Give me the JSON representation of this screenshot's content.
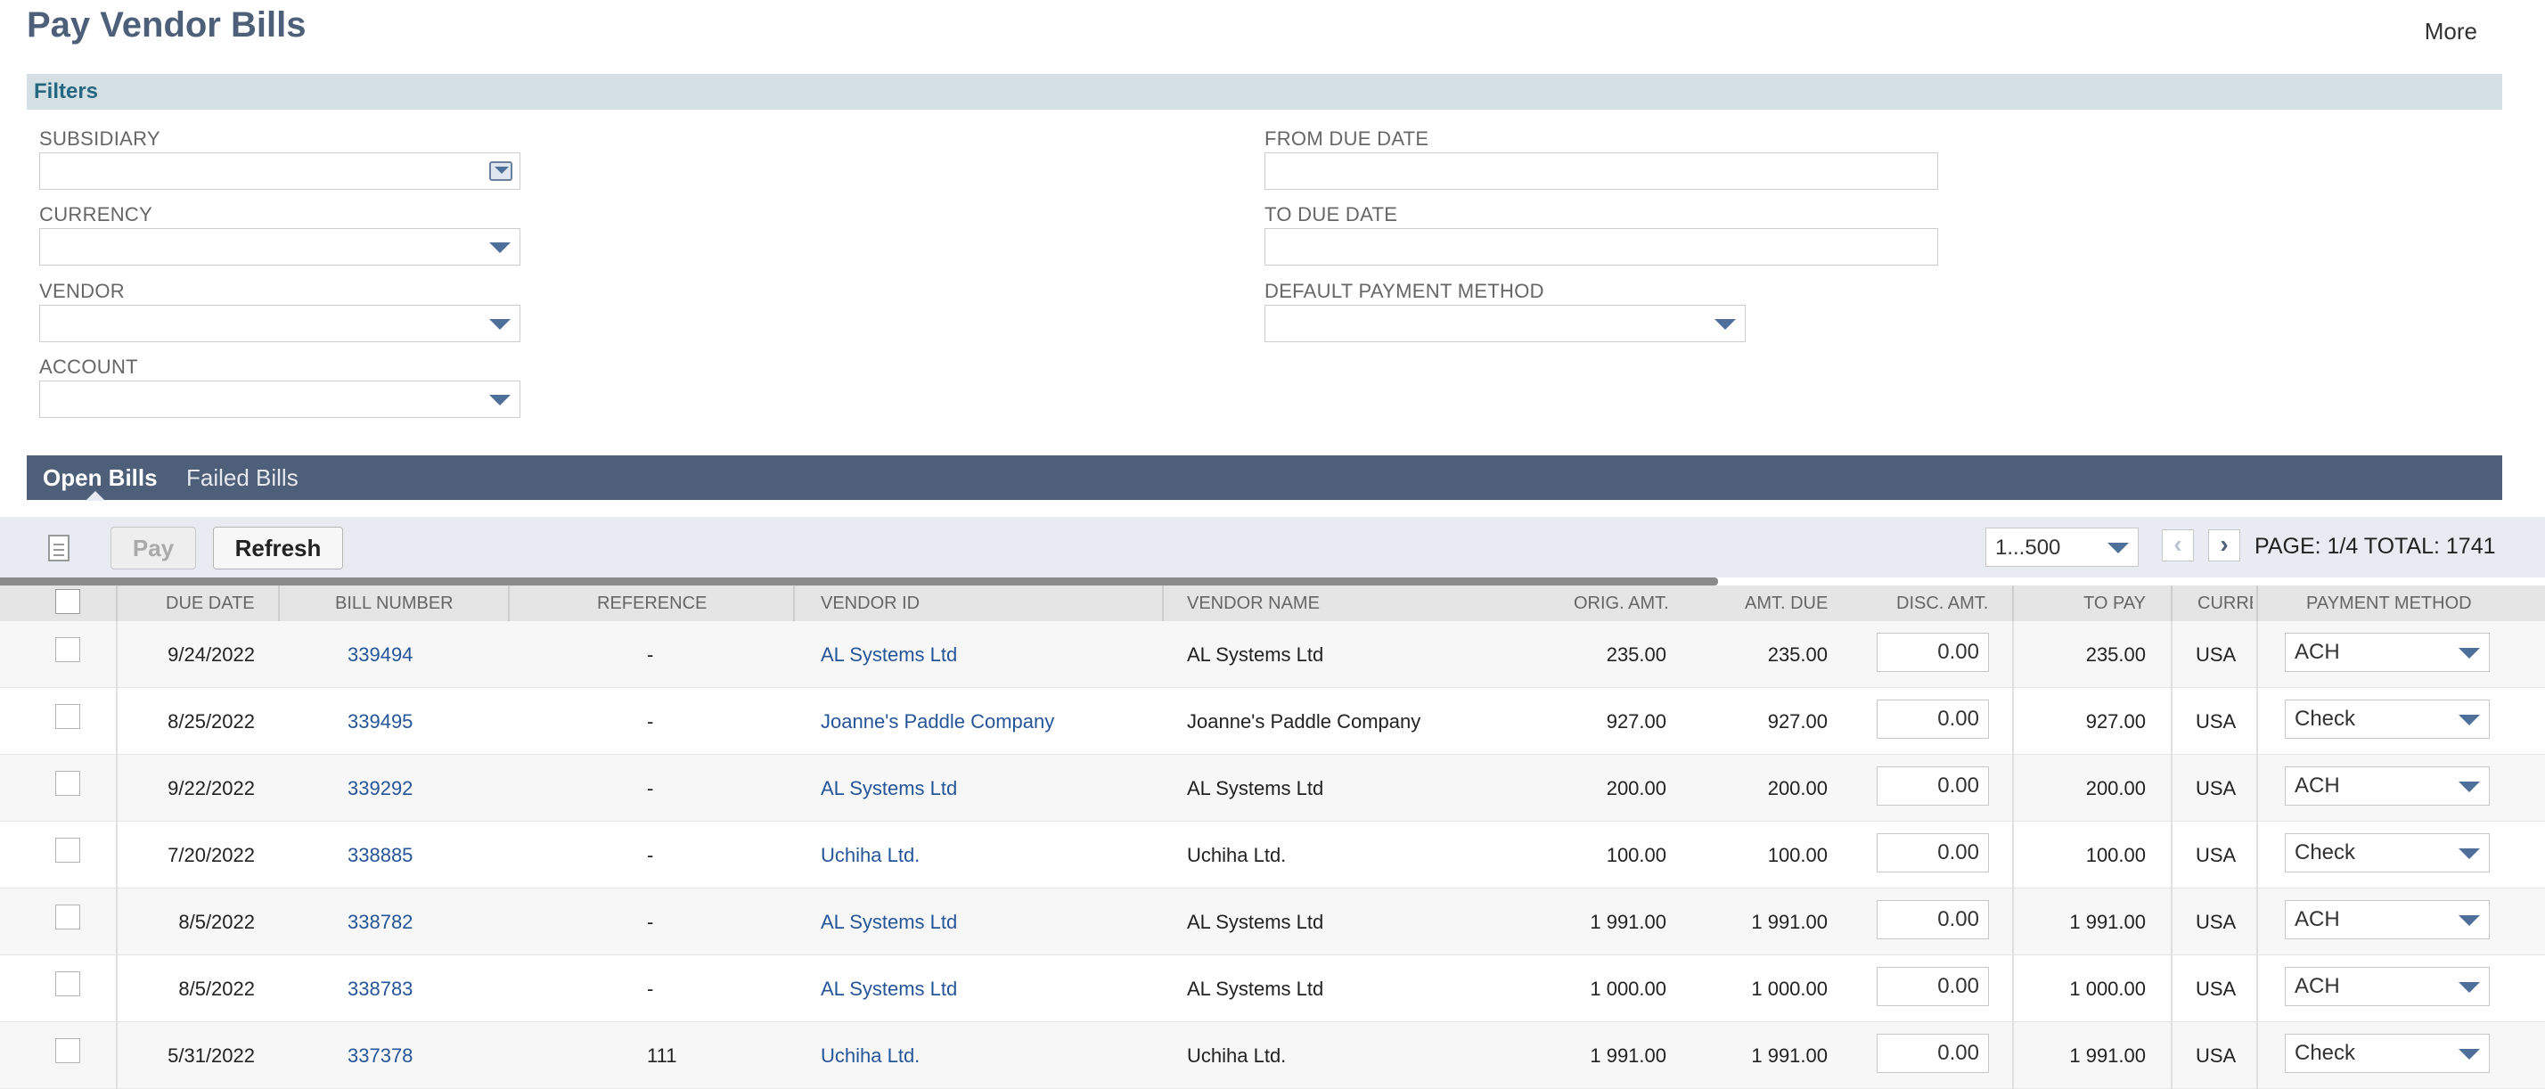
{
  "page": {
    "title": "Pay Vendor Bills",
    "more_label": "More"
  },
  "filters": {
    "section_label": "Filters",
    "subsidiary": {
      "label": "SUBSIDIARY",
      "value": ""
    },
    "currency": {
      "label": "CURRENCY",
      "value": ""
    },
    "vendor": {
      "label": "VENDOR",
      "value": ""
    },
    "account": {
      "label": "ACCOUNT",
      "value": ""
    },
    "from_due_date": {
      "label": "FROM DUE DATE",
      "value": ""
    },
    "to_due_date": {
      "label": "TO DUE DATE",
      "value": ""
    },
    "default_payment_method": {
      "label": "DEFAULT PAYMENT METHOD",
      "value": ""
    }
  },
  "tabs": [
    {
      "label": "Open Bills"
    },
    {
      "label": "Failed Bills"
    }
  ],
  "toolbar": {
    "pay_label": "Pay",
    "refresh_label": "Refresh",
    "page_range": "1...500",
    "prev_icon": "‹",
    "next_icon": "›",
    "page_info": "PAGE: 1/4  TOTAL: 1741"
  },
  "table": {
    "headers": {
      "due_date": "DUE DATE",
      "bill_number": "BILL NUMBER",
      "reference": "REFERENCE",
      "vendor_id": "VENDOR ID",
      "vendor_name": "VENDOR NAME",
      "orig_amt": "ORIG. AMT.",
      "amt_due": "AMT. DUE",
      "disc_amt": "DISC. AMT.",
      "to_pay": "TO PAY",
      "currency": "CURRE",
      "payment_method": "PAYMENT METHOD"
    },
    "rows": [
      {
        "due_date": "9/24/2022",
        "bill_number": "339494",
        "reference": "-",
        "vendor_id": "AL Systems Ltd",
        "vendor_name": "AL Systems Ltd",
        "orig_amt": "235.00",
        "amt_due": "235.00",
        "disc_amt": "0.00",
        "to_pay": "235.00",
        "currency": "USA",
        "payment_method": "ACH"
      },
      {
        "due_date": "8/25/2022",
        "bill_number": "339495",
        "reference": "-",
        "vendor_id": "Joanne's Paddle Company",
        "vendor_name": "Joanne's Paddle Company",
        "orig_amt": "927.00",
        "amt_due": "927.00",
        "disc_amt": "0.00",
        "to_pay": "927.00",
        "currency": "USA",
        "payment_method": "Check"
      },
      {
        "due_date": "9/22/2022",
        "bill_number": "339292",
        "reference": "-",
        "vendor_id": "AL Systems Ltd",
        "vendor_name": "AL Systems Ltd",
        "orig_amt": "200.00",
        "amt_due": "200.00",
        "disc_amt": "0.00",
        "to_pay": "200.00",
        "currency": "USA",
        "payment_method": "ACH"
      },
      {
        "due_date": "7/20/2022",
        "bill_number": "338885",
        "reference": "-",
        "vendor_id": "Uchiha Ltd.",
        "vendor_name": "Uchiha Ltd.",
        "orig_amt": "100.00",
        "amt_due": "100.00",
        "disc_amt": "0.00",
        "to_pay": "100.00",
        "currency": "USA",
        "payment_method": "Check"
      },
      {
        "due_date": "8/5/2022",
        "bill_number": "338782",
        "reference": "-",
        "vendor_id": "AL Systems Ltd",
        "vendor_name": "AL Systems Ltd",
        "orig_amt": "1 991.00",
        "amt_due": "1 991.00",
        "disc_amt": "0.00",
        "to_pay": "1 991.00",
        "currency": "USA",
        "payment_method": "ACH"
      },
      {
        "due_date": "8/5/2022",
        "bill_number": "338783",
        "reference": "-",
        "vendor_id": "AL Systems Ltd",
        "vendor_name": "AL Systems Ltd",
        "orig_amt": "1 000.00",
        "amt_due": "1 000.00",
        "disc_amt": "0.00",
        "to_pay": "1 000.00",
        "currency": "USA",
        "payment_method": "ACH"
      },
      {
        "due_date": "5/31/2022",
        "bill_number": "337378",
        "reference": "111",
        "vendor_id": "Uchiha Ltd.",
        "vendor_name": "Uchiha Ltd.",
        "orig_amt": "1 991.00",
        "amt_due": "1 991.00",
        "disc_amt": "0.00",
        "to_pay": "1 991.00",
        "currency": "USA",
        "payment_method": "Check"
      }
    ]
  }
}
